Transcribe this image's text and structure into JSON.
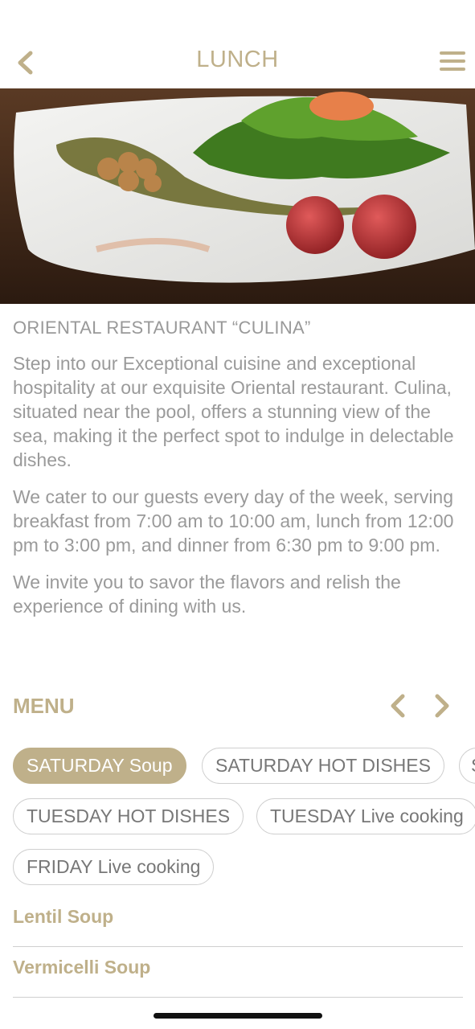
{
  "header": {
    "title": "LUNCH",
    "back_icon": "chevron-left-icon",
    "menu_icon": "hamburger-menu-icon",
    "accent_color": "#bfb08a"
  },
  "hero": {
    "image_subject": "plated salad with greens, walnuts, pesto and red grapes"
  },
  "restaurant": {
    "title": "ORIENTAL RESTAURANT “CULINA”",
    "paragraphs": [
      "Step into our Exceptional cuisine and exceptional hospitality at our exquisite Oriental restaurant. Culina, situated near the pool, offers a stunning view of the sea, making it the perfect spot to indulge in delectable dishes.",
      "We cater to our guests every day of the week, serving breakfast from 7:00 am to 10:00 am, lunch from 12:00 pm to 3:00 pm, and dinner from 6:30 pm to 9:00 pm.",
      "We invite you to savor the flavors and relish the experience of dining with us."
    ]
  },
  "menu": {
    "label": "MENU",
    "prev_icon": "chevron-left-icon",
    "next_icon": "chevron-right-icon",
    "chips": [
      {
        "label": "SATURDAY Soup",
        "active": true
      },
      {
        "label": "SATURDAY HOT DISHES",
        "active": false
      },
      {
        "label": "S",
        "active": false
      },
      {
        "label": "TUESDAY HOT DISHES",
        "active": false
      },
      {
        "label": "TUESDAY Live cooking",
        "active": false
      },
      {
        "label": "FRIDAY Live cooking",
        "active": false
      }
    ],
    "items": [
      "Lentil Soup",
      "Vermicelli Soup"
    ]
  }
}
